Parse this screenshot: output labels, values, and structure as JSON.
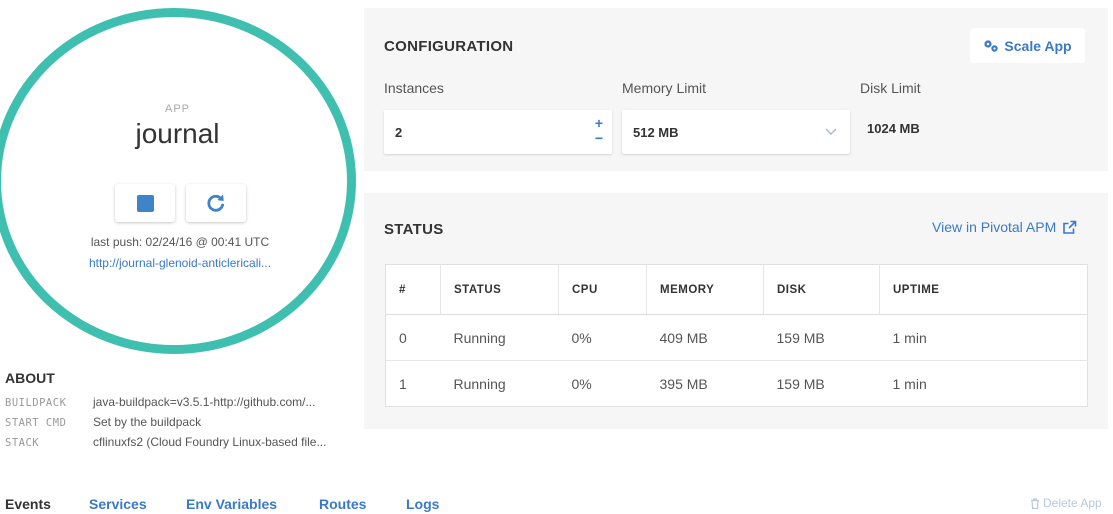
{
  "app": {
    "label": "APP",
    "name": "journal",
    "last_push": "last push: 02/24/16 @ 00:41 UTC",
    "url": "http://journal-glenoid-anticlericali..."
  },
  "about": {
    "title": "ABOUT",
    "rows": [
      {
        "key": "BUILDPACK",
        "value": "java-buildpack=v3.5.1-http://github.com/..."
      },
      {
        "key": "START CMD",
        "value": "Set by the buildpack"
      },
      {
        "key": "STACK",
        "value": "cflinuxfs2 (Cloud Foundry Linux-based file..."
      }
    ]
  },
  "configuration": {
    "title": "CONFIGURATION",
    "scale_button": "Scale App",
    "instances_label": "Instances",
    "instances_value": "2",
    "memory_label": "Memory Limit",
    "memory_value": "512 MB",
    "disk_label": "Disk Limit",
    "disk_value": "1024 MB"
  },
  "status": {
    "title": "STATUS",
    "apm_link": "View in Pivotal APM",
    "headers": [
      "#",
      "STATUS",
      "CPU",
      "MEMORY",
      "DISK",
      "UPTIME"
    ],
    "rows": [
      [
        "0",
        "Running",
        "0%",
        "409 MB",
        "159 MB",
        "1 min"
      ],
      [
        "1",
        "Running",
        "0%",
        "395 MB",
        "159 MB",
        "1 min"
      ]
    ]
  },
  "tabs": [
    {
      "label": "Events",
      "active": true
    },
    {
      "label": "Services",
      "active": false
    },
    {
      "label": "Env Variables",
      "active": false
    },
    {
      "label": "Routes",
      "active": false
    },
    {
      "label": "Logs",
      "active": false
    }
  ],
  "delete_app": "Delete App",
  "colors": {
    "accent": "#3fbfb0",
    "link": "#3a79c7",
    "card_bg": "#f6f6f6"
  },
  "icons": {
    "stop": "stop-icon",
    "restart": "restart-icon",
    "scale": "scale-icon",
    "external": "external-link-icon",
    "trash": "trash-icon"
  }
}
